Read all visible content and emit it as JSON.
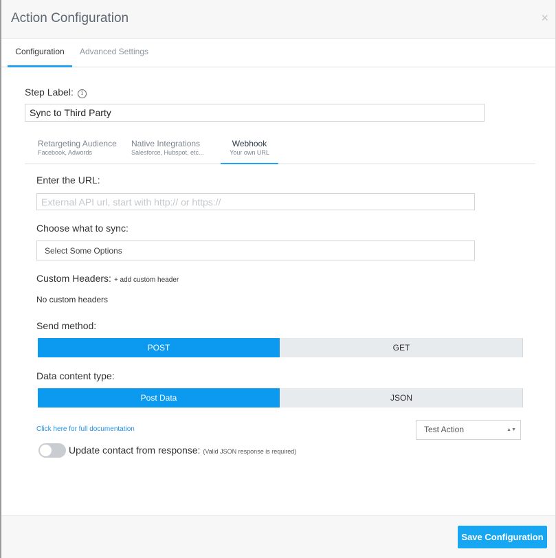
{
  "header": {
    "title": "Action Configuration",
    "close": "×"
  },
  "tabs": {
    "configuration": "Configuration",
    "advanced": "Advanced Settings"
  },
  "step": {
    "label": "Step Label:",
    "info_icon": "i",
    "value": "Sync to Third Party"
  },
  "subtabs": [
    {
      "title": "Retargeting Audience",
      "sub": "Facebook, Adwords"
    },
    {
      "title": "Native Integrations",
      "sub": "Salesforce, Hubspot, etc..."
    },
    {
      "title": "Webhook",
      "sub": "Your own URL"
    }
  ],
  "url": {
    "label": "Enter the URL:",
    "value": "",
    "placeholder": "External API url, start with http:// or https://"
  },
  "sync": {
    "label": "Choose what to sync:",
    "placeholder": "Select Some Options"
  },
  "headers": {
    "label": "Custom Headers:",
    "add_link": "+ add custom header",
    "empty_text": "No custom headers"
  },
  "send_method": {
    "label": "Send method:",
    "options": [
      "POST",
      "GET"
    ],
    "selected": "POST"
  },
  "content_type": {
    "label": "Data content type:",
    "options": [
      "Post Data",
      "JSON"
    ],
    "selected": "Post Data"
  },
  "doc_link": "Click here for full documentation",
  "test_action": {
    "value": "Test Action",
    "caret": "▲▼"
  },
  "update_contact": {
    "label": "Update contact from response:",
    "note": "(Valid JSON response is required)",
    "enabled": false
  },
  "footer": {
    "save_label": "Save Configuration"
  },
  "colors": {
    "accent": "#0b9af0",
    "save_button": "#17a6f2",
    "link": "#1e90e6"
  }
}
